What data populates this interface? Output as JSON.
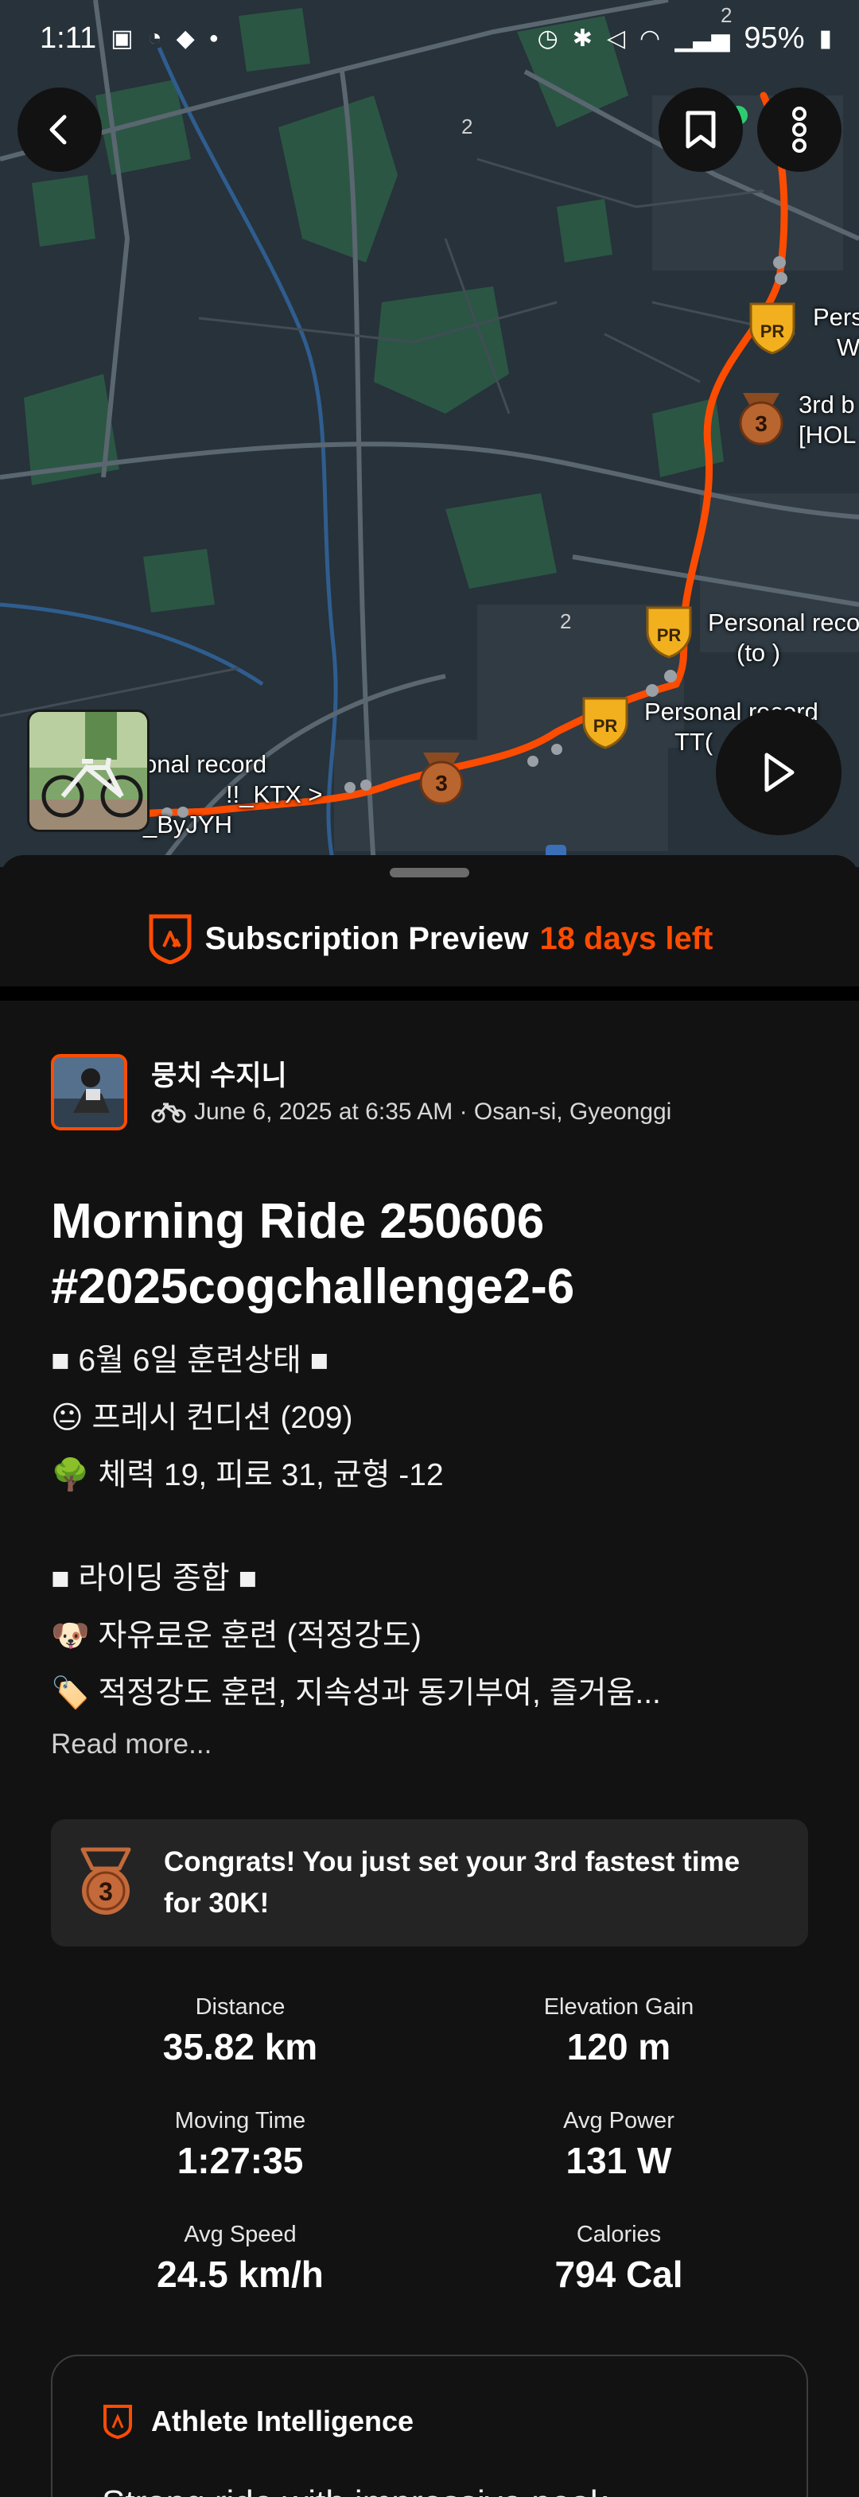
{
  "status_bar": {
    "time": "1:11",
    "battery": "95%"
  },
  "map": {
    "road_labels": [
      "2",
      "2",
      "2"
    ],
    "pr_labels": [
      {
        "line1": "Pers",
        "line2": "W"
      },
      {
        "line1": "3rd b",
        "line2": "[HOL"
      },
      {
        "line1": "Personal reco",
        "line2": "(to  )"
      },
      {
        "line1": "Personal record",
        "line2": "TT("
      },
      {
        "line1": "onal record",
        "line2": "!!_KTX  >",
        "line3": "_ByJYH"
      }
    ],
    "medal_rank": "3",
    "pr_badge": "PR"
  },
  "subscription": {
    "label": "Subscription Preview",
    "days_left": "18 days left"
  },
  "activity": {
    "athlete_name": "뭉치 수지니",
    "meta": "June 6, 2025 at 6:35 AM · Osan-si, Gyeonggi",
    "title_line1": "Morning Ride 250606",
    "title_line2": "#2025cogchallenge2-6",
    "description": [
      "■ 6월 6일 훈련상태 ■",
      "😐 프레시 컨디션 (209)",
      "🌳 체력 19, 피로 31, 균형 -12",
      "",
      "■ 라이딩 종합 ■",
      "🐶 자유로운 훈련 (적정강도)",
      "🏷️ 적정강도 훈련, 지속성과 동기부여, 즐거움..."
    ],
    "read_more": "Read more..."
  },
  "congrats": {
    "rank": "3",
    "text": "Congrats! You just set your 3rd fastest time for 30K!"
  },
  "stats": [
    {
      "label": "Distance",
      "value": "35.82 km"
    },
    {
      "label": "Elevation Gain",
      "value": "120 m"
    },
    {
      "label": "Moving Time",
      "value": "1:27:35"
    },
    {
      "label": "Avg Power",
      "value": "131 W"
    },
    {
      "label": "Avg Speed",
      "value": "24.5 km/h"
    },
    {
      "label": "Calories",
      "value": "794 Cal"
    }
  ],
  "athlete_intelligence": {
    "title": "Athlete Intelligence",
    "body": "Strong ride with impressive peak"
  },
  "colors": {
    "accent": "#fc4c02",
    "background": "#121212",
    "card": "#242424",
    "map_bg": "#27323a",
    "route": "#fc4c02",
    "pr_gold": "#f2b01e",
    "medal_bronze": "#b8652f"
  },
  "icons": [
    "back-arrow-icon",
    "bookmark-icon",
    "more-vertical-icon",
    "play-icon",
    "strava-subscription-icon",
    "bike-icon",
    "bronze-medal-icon",
    "athlete-intelligence-icon"
  ]
}
